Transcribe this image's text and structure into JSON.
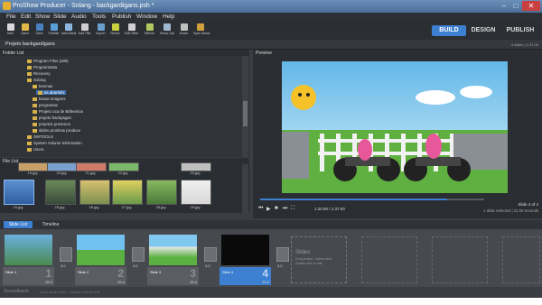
{
  "window": {
    "title": "ProShow Producer - Solang - backgardigans.psh *"
  },
  "menu": [
    "File",
    "Edit",
    "Show",
    "Slide",
    "Audio",
    "Tools",
    "Publish",
    "Window",
    "Help"
  ],
  "toolbar": [
    {
      "label": "New",
      "icon": "new-icon",
      "color": "#d9d9d9"
    },
    {
      "label": "Open",
      "icon": "open-icon",
      "color": "#e0b84a"
    },
    {
      "label": "Save",
      "icon": "save-icon",
      "color": "#4a7fc0"
    },
    {
      "label": "Publish",
      "icon": "publish-icon",
      "color": "#5aa0d8"
    },
    {
      "label": "Add Blank",
      "icon": "add-blank-icon",
      "color": "#8cb8e0"
    },
    {
      "label": "Add Title",
      "icon": "add-title-icon",
      "color": "#d0d0d0"
    },
    {
      "label": "Import",
      "icon": "import-icon",
      "color": "#6aa0d0"
    },
    {
      "label": "Remix",
      "icon": "remix-icon",
      "color": "#c8d040"
    },
    {
      "label": "Edit Slide",
      "icon": "edit-slide-icon",
      "color": "#d0d0d0"
    },
    {
      "label": "Effects",
      "icon": "effects-icon",
      "color": "#b0c860"
    },
    {
      "label": "Show Opt",
      "icon": "show-options-icon",
      "color": "#a0b8d0"
    },
    {
      "label": "Music",
      "icon": "music-icon",
      "color": "#c0c0c0"
    },
    {
      "label": "Sync Music",
      "icon": "sync-music-icon",
      "color": "#d0a040"
    }
  ],
  "modes": {
    "build": "BUILD",
    "design": "DESIGN",
    "publish": "PUBLISH"
  },
  "project": {
    "name": "Projeto backgardigans",
    "count": "4 slides | 1:37.00"
  },
  "folder_list": {
    "title": "Folder List",
    "items": [
      {
        "label": "Program Files (x86)",
        "indent": 0
      },
      {
        "label": "ProgramData",
        "indent": 0
      },
      {
        "label": "Recovery",
        "indent": 0
      },
      {
        "label": "Solang",
        "indent": 0
      },
      {
        "label": "besmas",
        "indent": 1
      },
      {
        "label": "as abartelis",
        "indent": 2,
        "selected": true
      },
      {
        "label": "besas imagens",
        "indent": 1
      },
      {
        "label": "programas",
        "indent": 1
      },
      {
        "label": "Projeto oca de Bitfeetnox",
        "indent": 1
      },
      {
        "label": "projeto backyagan",
        "indent": 1
      },
      {
        "label": "projetos presenos",
        "indent": 1
      },
      {
        "label": "slides proshow produce",
        "indent": 1
      },
      {
        "label": "SWTOOLS",
        "indent": 0
      },
      {
        "label": "System Volume Information",
        "indent": 0
      },
      {
        "label": "Users",
        "indent": 0
      }
    ]
  },
  "file_list": {
    "title": "File List",
    "row1": [
      "19.jpg",
      "20.jpg",
      "21.jpg",
      "22.jpg",
      "23.jpg"
    ],
    "row2": [
      "24.jpg",
      "25.jpg",
      "26.jpg",
      "27.jpg",
      "28.jpg",
      "29.jpg"
    ]
  },
  "preview": {
    "title": "Preview",
    "time": "1:20.90 / 1:37.00",
    "slide_info": "Slide 4 of 4",
    "selection": "1 Slide Selected | 31.00 seconds"
  },
  "tabs": {
    "slide_list": "Slide List",
    "timeline": "Timeline"
  },
  "slides": [
    {
      "name": "Slide 1",
      "number": "1",
      "duration": "25.0",
      "transition": "3.0"
    },
    {
      "name": "Slide 2",
      "number": "2",
      "duration": "25.0",
      "transition": "3.0"
    },
    {
      "name": "Slide 3",
      "number": "3",
      "duration": "25.0",
      "transition": "3.0"
    },
    {
      "name": "Slide 4",
      "number": "4",
      "duration": "25.0",
      "transition": "3.0"
    }
  ],
  "empty_slot": {
    "title": "Slides",
    "line1": "Drop photos / videos here",
    "line2": "Double click to edit"
  },
  "soundtrack": {
    "label": "Soundtrack",
    "hint": "Drop music here - Double click to edit"
  }
}
